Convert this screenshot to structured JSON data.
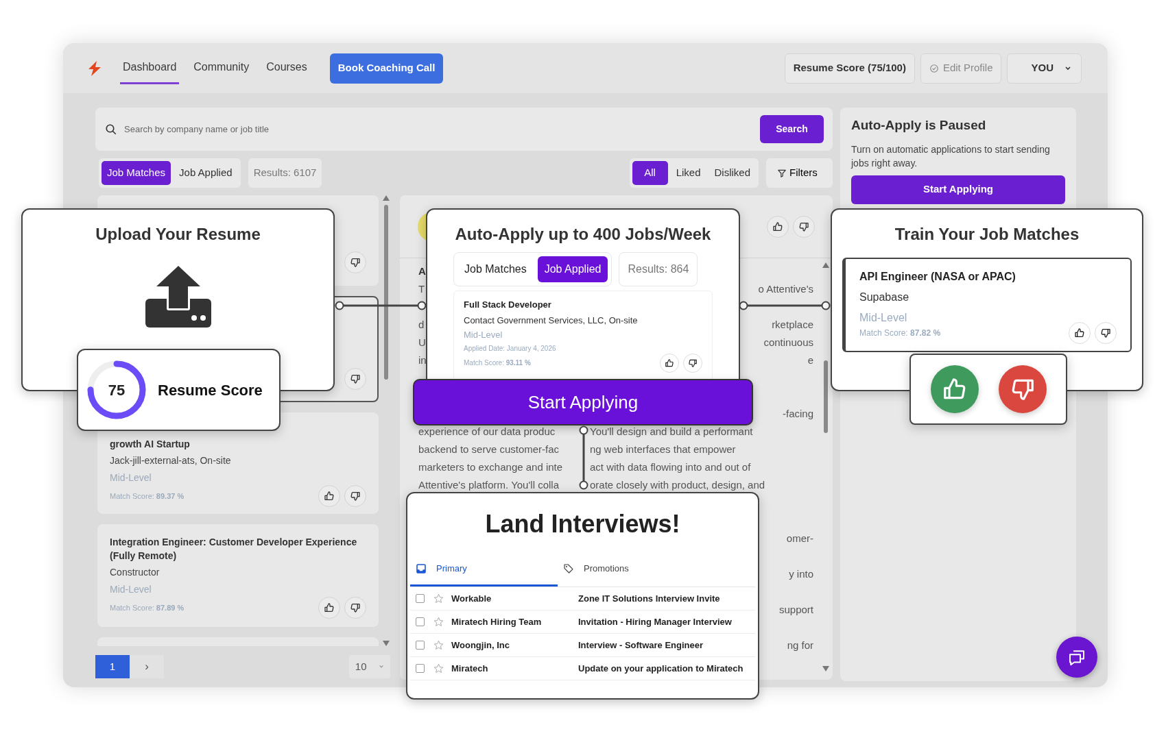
{
  "nav": {
    "items": [
      {
        "label": "Dashboard",
        "selected": true
      },
      {
        "label": "Community",
        "selected": false
      },
      {
        "label": "Courses",
        "selected": false
      }
    ],
    "cta": "Book Coaching Call",
    "resume_score": "Resume Score (75/100)",
    "edit_profile": "Edit Profile",
    "user": "YOU"
  },
  "search": {
    "placeholder": "Search by company name or job title",
    "button": "Search"
  },
  "list_tabs": [
    {
      "label": "Job Matches",
      "selected": true
    },
    {
      "label": "Job Applied",
      "selected": false
    }
  ],
  "results": "Results: 6107",
  "filters": [
    {
      "label": "All",
      "selected": true
    },
    {
      "label": "Liked",
      "selected": false
    },
    {
      "label": "Disliked",
      "selected": false
    }
  ],
  "filters_button": "Filters",
  "job_list": [
    {
      "selected": false
    },
    {
      "selected": true
    },
    {
      "title": "growth AI Startup",
      "company": "Jack-jill-external-ats, On-site",
      "level": "Mid-Level",
      "match": "Match Score: **89.37 %**",
      "selected": false
    },
    {
      "title": "Integration Engineer: Customer Developer Experience (Fully Remote)",
      "company": "Constructor",
      "level": "Mid-Level",
      "match": "Match Score: **87.89 %**",
      "selected": false
    },
    {
      "selected": false
    }
  ],
  "pagination": {
    "pages": [
      {
        "label": "1",
        "selected": true
      }
    ],
    "next": "›",
    "page_size": "10"
  },
  "detail": {
    "blocks": [
      [
        {
          "left": "A"
        },
        {
          "left": "T",
          "right": "o Attentive's"
        },
        {
          "left": "d",
          "right": "rketplace"
        },
        {
          "left": "U",
          "right": "continuous"
        },
        {
          "left": "in",
          "right": "e"
        }
      ],
      [
        {
          "right": "-facing"
        },
        {
          "left": "experience of our data produc",
          "middle": "You'll design and build a performant"
        },
        {
          "left": "backend to serve customer-fac",
          "middle": "ng web interfaces that empower"
        },
        {
          "left": "marketers to exchange and inte",
          "middle": "act with data flowing into and out of"
        },
        {
          "left": "Attentive's platform. You'll colla",
          "middle": "orate closely with product, design, and"
        }
      ],
      [
        {
          "right": "omer-"
        }
      ],
      [
        {
          "right": "y into"
        }
      ],
      [
        {
          "right": "support"
        }
      ],
      [
        {
          "right": "ng for"
        }
      ]
    ]
  },
  "auto_apply_panel": {
    "title": "Auto-Apply is Paused",
    "text": "Turn on automatic applications to start sending jobs right away.",
    "button": "Start Applying"
  },
  "callouts": {
    "upload": {
      "title": "Upload Your Resume"
    },
    "score": {
      "value": "75",
      "level": 0.75,
      "label": "Resume Score"
    },
    "auto_apply": {
      "title": "Auto-Apply up to 400 Jobs/Week",
      "tabs": [
        {
          "label": "Job Matches",
          "selected": false
        },
        {
          "label": "Job Applied",
          "selected": true
        }
      ],
      "results": "Results: 864",
      "job": {
        "title": "Full Stack Developer",
        "company": "Contact Government Services, LLC, On-site",
        "level": "Mid-Level",
        "date": "Applied Date: January 4, 2026",
        "match": "Match Score: **93.11 %**"
      }
    },
    "start_button": "Start Applying",
    "interviews": {
      "title": "Land Interviews!",
      "tabs": [
        {
          "label": "Primary",
          "kind": "inbox",
          "selected": true
        },
        {
          "label": "Promotions",
          "kind": "tag",
          "selected": false
        }
      ],
      "emails": [
        {
          "sender": "Workable",
          "subject": "Zone IT Solutions Interview Invite",
          "checked": false,
          "starred": false
        },
        {
          "sender": "Miratech Hiring Team",
          "subject": "Invitation - Hiring Manager Interview",
          "checked": false,
          "starred": false
        },
        {
          "sender": "Woongjin, Inc",
          "subject": "Interview - Software Engineer",
          "checked": false,
          "starred": false
        },
        {
          "sender": "Miratech",
          "subject": "Update on your application to Miratech",
          "checked": false,
          "starred": false
        }
      ]
    },
    "train": {
      "title": "Train Your Job Matches",
      "job": {
        "title": "API Engineer (NASA or APAC)",
        "company": "Supabase",
        "level": "Mid-Level",
        "match": "Match Score: **87.82 %**"
      }
    }
  }
}
